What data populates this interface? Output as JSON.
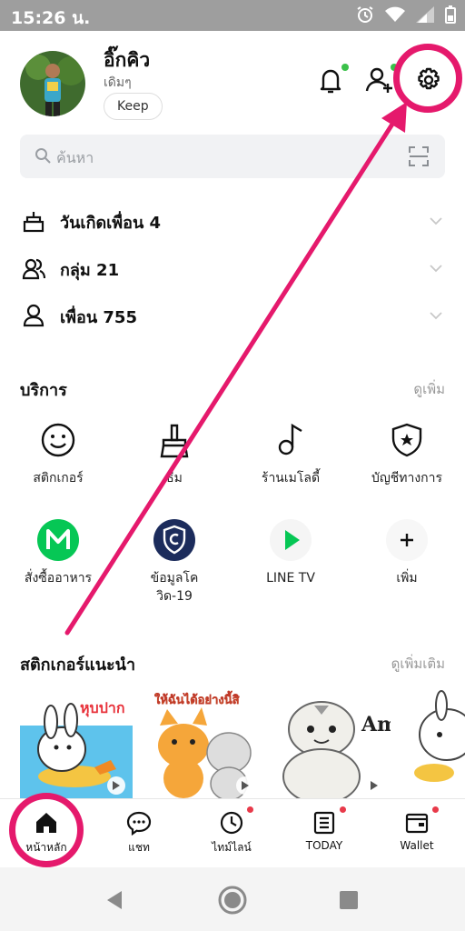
{
  "status_bar": {
    "time": "15:26 น."
  },
  "profile": {
    "name": "อิ๊กคิว",
    "status": "เดิมๆ",
    "keep_label": "Keep"
  },
  "search": {
    "placeholder": "ค้นหา"
  },
  "friends": [
    {
      "label": "วันเกิดเพื่อน 4",
      "icon": "birthday-cake-icon"
    },
    {
      "label": "กลุ่ม 21",
      "icon": "group-icon"
    },
    {
      "label": "เพื่อน 755",
      "icon": "person-icon"
    }
  ],
  "services": {
    "title": "บริการ",
    "more": "ดูเพิ่ม",
    "items": [
      {
        "label": "สติกเกอร์",
        "icon": "smiley-icon"
      },
      {
        "label": "ธีม",
        "icon": "brush-icon"
      },
      {
        "label": "ร้านเมโลดี้",
        "icon": "music-note-icon"
      },
      {
        "label": "บัญชีทางการ",
        "icon": "shield-star-icon"
      },
      {
        "label": "สั่งซื้ออาหาร",
        "icon": "line-man-icon"
      },
      {
        "label": "ข้อมูลโควิด-19",
        "label_line1": "ข้อมูลโค",
        "label_line2": "วิด-19",
        "icon": "covid-shield-icon"
      },
      {
        "label": "LINE TV",
        "icon": "play-icon"
      },
      {
        "label": "เพิ่ม",
        "icon": "plus-icon"
      }
    ]
  },
  "stickers": {
    "title": "สติกเกอร์แนะนำ",
    "more": "ดูเพิ่มเติม",
    "captions": [
      "หุบปาก",
      "ให้ฉันได้อย่างนี้สิ",
      "Ami"
    ]
  },
  "tabs": [
    {
      "label": "หน้าหลัก",
      "icon": "home-icon"
    },
    {
      "label": "แชท",
      "icon": "chat-icon"
    },
    {
      "label": "ไทม์ไลน์",
      "icon": "clock-icon"
    },
    {
      "label": "TODAY",
      "icon": "news-icon"
    },
    {
      "label": "Wallet",
      "icon": "wallet-icon"
    }
  ],
  "colors": {
    "highlight": "#e5196c",
    "line_green": "#06c755",
    "badge_green": "#3bc14a",
    "badge_red": "#e83a4a"
  }
}
